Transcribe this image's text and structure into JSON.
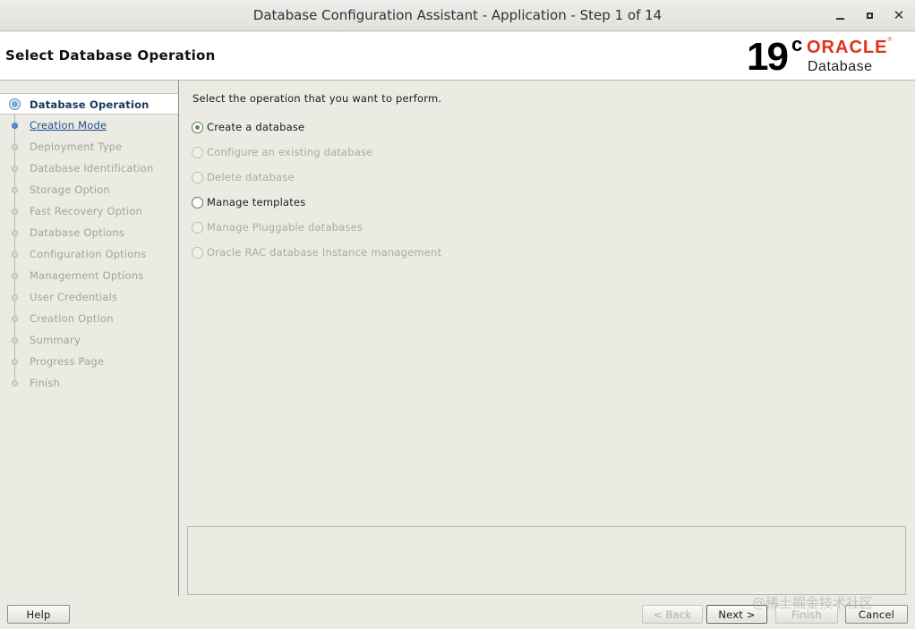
{
  "window": {
    "title": "Database Configuration Assistant - Application - Step 1 of 14",
    "controls": {
      "minimize": "minimize-icon",
      "maximize": "maximize-icon",
      "close": "close-icon"
    }
  },
  "header": {
    "page_title": "Select Database Operation",
    "logo": {
      "version": "19",
      "version_suffix": "c",
      "brand": "ORACLE",
      "registered": "®",
      "product": "Database"
    }
  },
  "sidebar": {
    "steps": [
      {
        "label": "Database Operation",
        "state": "active"
      },
      {
        "label": "Creation Mode",
        "state": "link"
      },
      {
        "label": "Deployment Type",
        "state": "disabled"
      },
      {
        "label": "Database Identification",
        "state": "disabled"
      },
      {
        "label": "Storage Option",
        "state": "disabled"
      },
      {
        "label": "Fast Recovery Option",
        "state": "disabled"
      },
      {
        "label": "Database Options",
        "state": "disabled"
      },
      {
        "label": "Configuration Options",
        "state": "disabled"
      },
      {
        "label": "Management Options",
        "state": "disabled"
      },
      {
        "label": "User Credentials",
        "state": "disabled"
      },
      {
        "label": "Creation Option",
        "state": "disabled"
      },
      {
        "label": "Summary",
        "state": "disabled"
      },
      {
        "label": "Progress Page",
        "state": "disabled"
      },
      {
        "label": "Finish",
        "state": "disabled"
      }
    ]
  },
  "main": {
    "instruction": "Select the operation that you want to perform.",
    "options": [
      {
        "label": "Create a database",
        "checked": true,
        "enabled": true
      },
      {
        "label": "Configure an existing database",
        "checked": false,
        "enabled": false
      },
      {
        "label": "Delete database",
        "checked": false,
        "enabled": false
      },
      {
        "label": "Manage templates",
        "checked": false,
        "enabled": true
      },
      {
        "label": "Manage Pluggable databases",
        "checked": false,
        "enabled": false
      },
      {
        "label": "Oracle RAC database Instance management",
        "checked": false,
        "enabled": false
      }
    ],
    "message": ""
  },
  "buttons": {
    "help": "Help",
    "back": "< Back",
    "next": "Next >",
    "finish": "Finish",
    "cancel": "Cancel"
  },
  "watermark": "@稀土掘金技术社区",
  "colors": {
    "brand_red": "#e0321a",
    "active_step": "#17375e",
    "link": "#1f4e8c",
    "radio_selected": "#4c9a3c"
  }
}
